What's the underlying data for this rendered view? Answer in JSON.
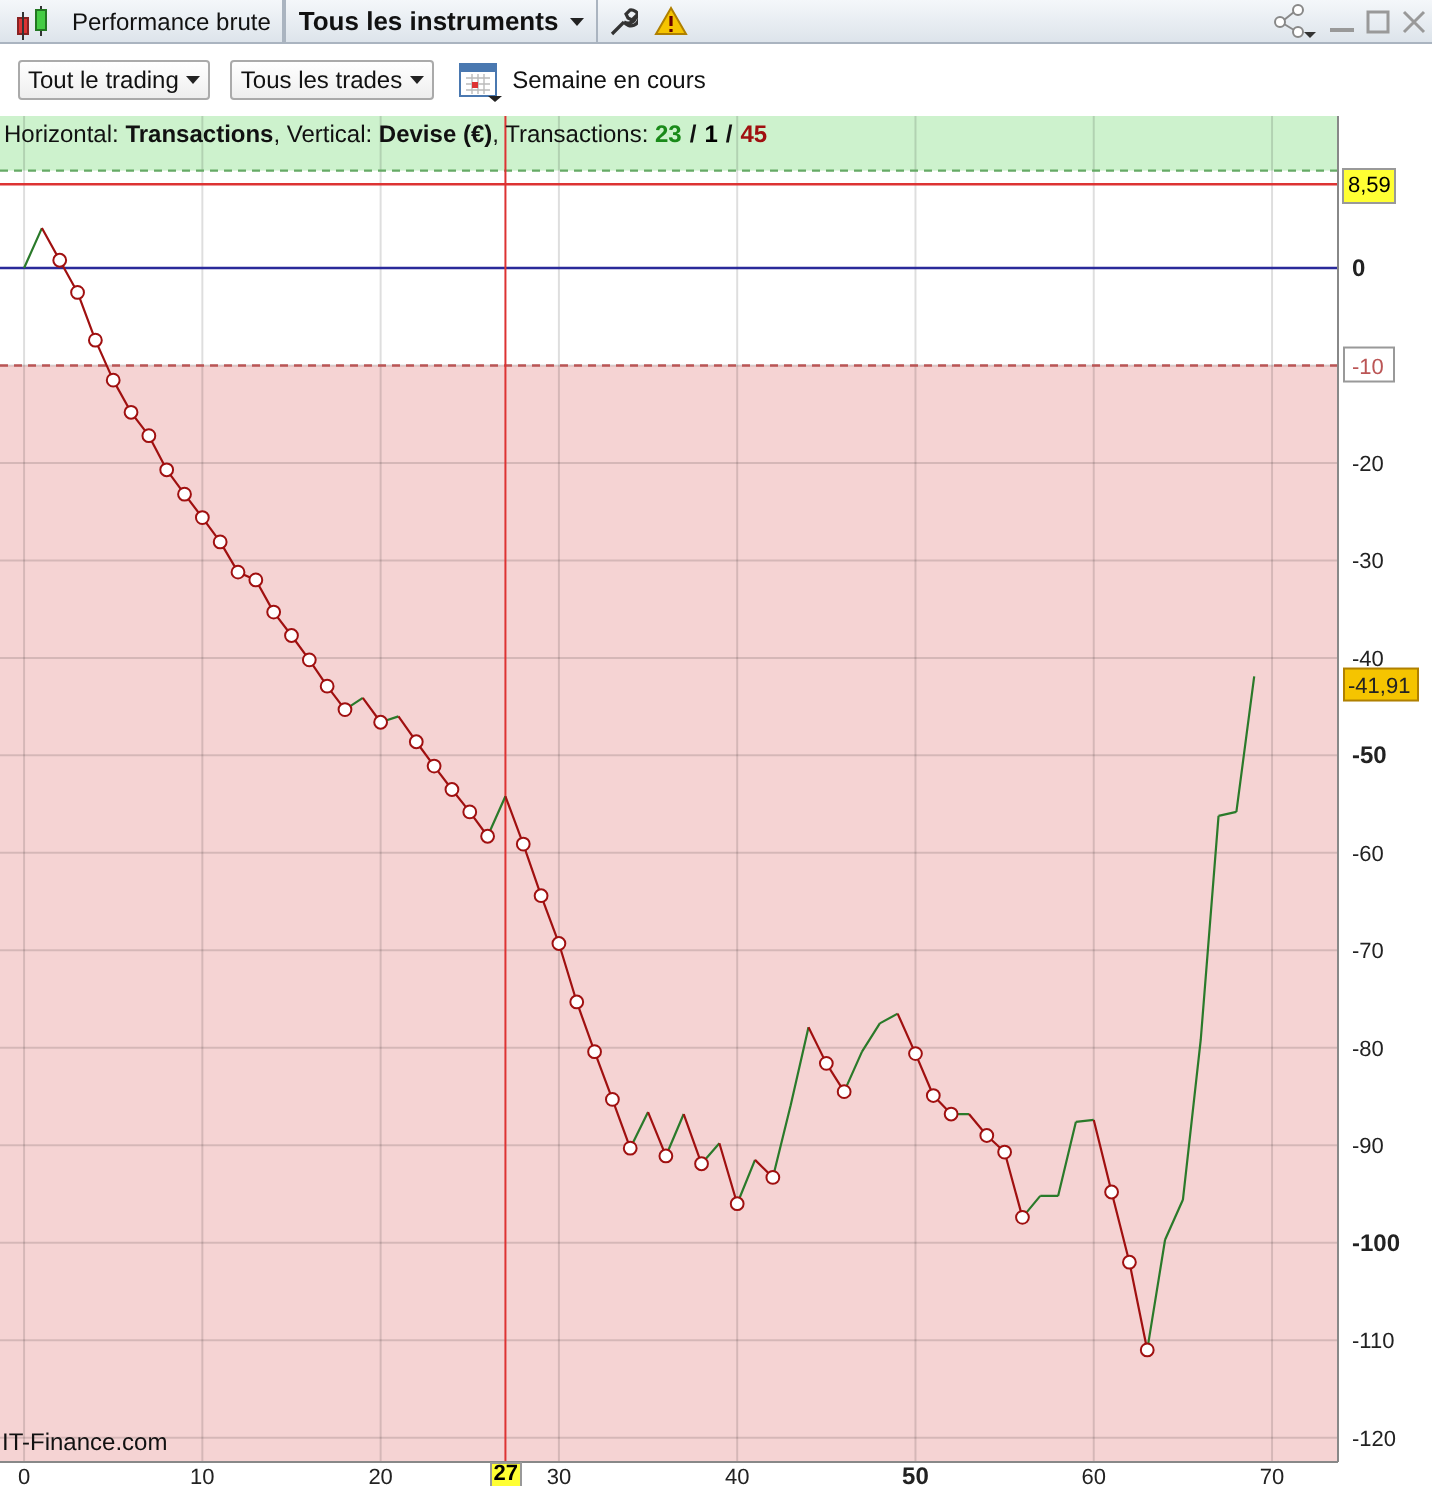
{
  "tabs": [
    {
      "label": "Performance brute",
      "selected": false,
      "has_menu": false
    },
    {
      "label": "Tous les instruments",
      "selected": true,
      "has_menu": true
    }
  ],
  "warning": true,
  "toolbar": {
    "filters": [
      "Tout le trading",
      "Tous les trades"
    ],
    "period": "Semaine en cours"
  },
  "chart": {
    "info": "Horizontal: **Transactions**, Vertical: **Devise (€)**, Transactions: ",
    "counts": [
      {
        "text": "23",
        "color": "#1a8a1a"
      },
      {
        "text": "1",
        "color": "#000000"
      },
      {
        "text": "45",
        "color": "#a01010"
      }
    ],
    "separator": "/",
    "watermark": "IT-Finance.com",
    "chart_data": {
      "type": "line",
      "grid": true,
      "xlim": [
        -1.35,
        73.7
      ],
      "ylim": [
        -122.5,
        15.6
      ],
      "xticks": [
        0,
        10,
        20,
        30,
        40,
        {
          "value": 50,
          "label": "50"
        },
        60,
        70
      ],
      "yticks": [
        {
          "value": 0,
          "label": "0"
        },
        {
          "value": -10,
          "label": "-10"
        },
        -20,
        -30,
        -40,
        {
          "value": -50,
          "label": "-50"
        },
        -60,
        -70,
        -80,
        -90,
        {
          "value": -100,
          "label": "-100"
        },
        -110,
        -120
      ],
      "x": [
        0,
        1,
        2,
        3,
        4,
        5,
        6,
        7,
        8,
        9,
        10,
        11,
        12,
        13,
        14,
        15,
        16,
        17,
        18,
        19,
        20,
        21,
        22,
        23,
        24,
        25,
        26,
        27,
        28,
        29,
        30,
        31,
        32,
        33,
        34,
        35,
        36,
        37,
        38,
        39,
        40,
        41,
        42,
        43,
        44,
        45,
        46,
        47,
        48,
        49,
        50,
        51,
        52,
        53,
        54,
        55,
        56,
        57,
        58,
        59,
        60,
        61,
        62,
        63,
        64,
        65,
        66,
        67,
        68,
        69
      ],
      "series": [
        {
          "color": "#2a7a2a",
          "values": [
            0,
            4.1,
            null,
            null,
            null,
            null,
            null,
            null,
            null,
            null,
            null,
            null,
            null,
            null,
            null,
            null,
            null,
            null,
            null,
            null,
            -46.6,
            -46,
            null,
            null,
            null,
            null,
            null,
            null,
            null,
            null,
            null,
            null,
            null,
            null,
            -90.3,
            -86.6,
            null,
            null,
            -91.9,
            -89.8,
            null,
            null,
            -93.3,
            -85.9,
            -77.9,
            null,
            null,
            null,
            null,
            null,
            null,
            null,
            -86.8,
            -86.8,
            null,
            null,
            null,
            null,
            null,
            null,
            null,
            null,
            null,
            -111,
            -99.7,
            -95.6,
            -79.2,
            -56.2,
            -55.8,
            -41.9
          ]
        },
        {
          "color": "#2a7a2a",
          "values": [
            null,
            null,
            null,
            null,
            null,
            null,
            null,
            null,
            null,
            null,
            null,
            null,
            null,
            null,
            null,
            null,
            null,
            null,
            -45.3,
            -44.1,
            null,
            null,
            null,
            null,
            null,
            null,
            -58.3,
            -54.2,
            null,
            null,
            null,
            null,
            null,
            null,
            null,
            null,
            -91.1,
            -86.8,
            null,
            null,
            -96,
            -91.5,
            null,
            null,
            null,
            null,
            -84.5,
            -80.4,
            -77.5,
            -76.5,
            null,
            null,
            null,
            null,
            null,
            null,
            -97.4,
            -95.2,
            -95.2,
            -87.6,
            -87.4,
            null,
            null,
            null,
            null,
            null,
            null,
            null,
            null,
            null
          ]
        },
        {
          "color": "#a01010",
          "marker": "o",
          "values": [
            null,
            4.1,
            0.8,
            -2.5,
            -7.4,
            -11.5,
            -14.8,
            -17.2,
            -20.7,
            -23.2,
            -25.6,
            -28.1,
            -31.2,
            -32,
            -35.3,
            -37.7,
            -40.2,
            -42.9,
            -45.3,
            null,
            null,
            -46,
            -48.6,
            -51.1,
            -53.5,
            -55.8,
            -58.3,
            null,
            null,
            null,
            null,
            null,
            null,
            null,
            null,
            -86.6,
            -91.1,
            null,
            null,
            -89.8,
            -96,
            null,
            null,
            null,
            -77.9,
            -81.6,
            -84.5,
            null,
            null,
            null,
            null,
            null,
            null,
            -86.8,
            -89,
            -90.7,
            -97.4,
            null,
            null,
            null,
            null,
            null,
            null,
            null,
            null,
            null,
            null,
            null,
            null,
            null
          ]
        },
        {
          "color": "#a01010",
          "marker": "o",
          "values": [
            null,
            null,
            null,
            null,
            null,
            null,
            null,
            null,
            null,
            null,
            null,
            null,
            null,
            null,
            null,
            null,
            null,
            null,
            null,
            -44.1,
            -46.6,
            null,
            null,
            null,
            null,
            null,
            null,
            -54.2,
            -59.1,
            -64.4,
            -69.3,
            -75.3,
            -80.4,
            -85.3,
            -90.3,
            null,
            null,
            -86.8,
            -91.9,
            null,
            null,
            -91.5,
            -93.3,
            null,
            null,
            null,
            null,
            null,
            null,
            -76.5,
            -80.6,
            -84.9,
            -86.8,
            null,
            null,
            null,
            null,
            null,
            null,
            null,
            -87.4,
            -94.8,
            -102,
            -111,
            null,
            null,
            null,
            null,
            null,
            null
          ]
        }
      ],
      "bands": [
        {
          "axis": "y",
          "from": 10,
          "to": 15.6,
          "color": "#cdf2cd"
        },
        {
          "axis": "y",
          "from": -122.5,
          "to": -10,
          "color": "#f5d3d3"
        }
      ],
      "ref_lines": [
        {
          "axis": "y",
          "value": 10,
          "color": "#66aa66"
        },
        {
          "axis": "y",
          "value": -10,
          "color": "#bb5555"
        },
        {
          "axis": "y",
          "value": 8.59,
          "color": "#dd3333",
          "label": "8,59"
        },
        {
          "axis": "y",
          "value": 0,
          "color": "#2a2a9a"
        },
        {
          "axis": "x",
          "value": 27,
          "color": "#dd3333",
          "label": "27"
        }
      ],
      "annotations": [
        {
          "x": 73.7,
          "y": -41.91,
          "text": "-41,91"
        }
      ]
    }
  }
}
